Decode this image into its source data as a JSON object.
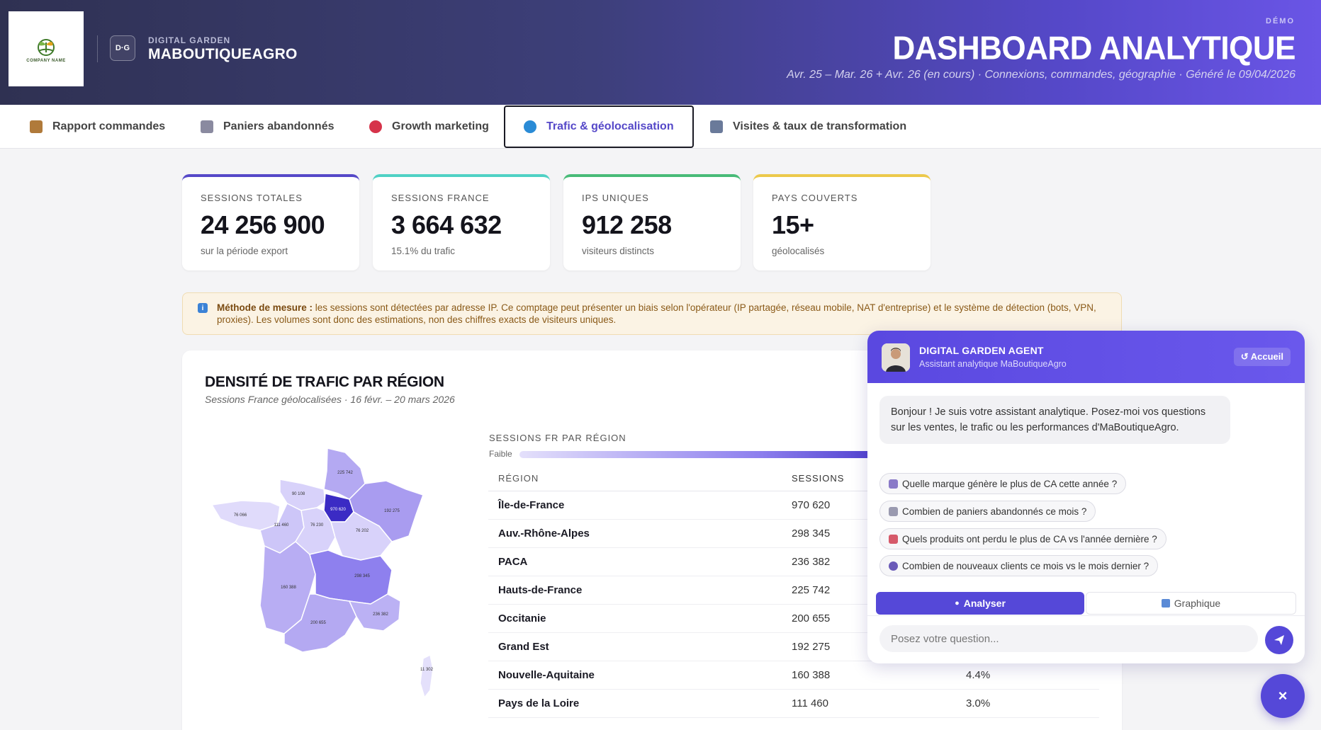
{
  "header": {
    "logo_text": "COMPANY NAME",
    "badge": "D·G",
    "brand_small": "DIGITAL GARDEN",
    "brand_big": "MABOUTIQUEAGRO",
    "demo": "DÉMO",
    "title": "DASHBOARD ANALYTIQUE",
    "subtitle": "Avr. 25 – Mar. 26 + Avr. 26 (en cours) · Connexions, commandes, géographie · Généré le 09/04/2026"
  },
  "tabs": [
    {
      "label": "Rapport commandes",
      "icon": "package-icon",
      "color": "#b07a3a"
    },
    {
      "label": "Paniers abandonnés",
      "icon": "cart-icon",
      "color": "#8a8aa0"
    },
    {
      "label": "Growth marketing",
      "icon": "target-icon",
      "color": "#d6334a"
    },
    {
      "label": "Trafic & géolocalisation",
      "icon": "globe-icon",
      "color": "#2a8bd6"
    },
    {
      "label": "Visites & taux de transformation",
      "icon": "chart-up-icon",
      "color": "#6a7a9a"
    }
  ],
  "kpis": [
    {
      "label": "SESSIONS TOTALES",
      "value": "24 256 900",
      "sub": "sur la période export",
      "color": "#5548c8"
    },
    {
      "label": "SESSIONS FRANCE",
      "value": "3 664 632",
      "sub": "15.1% du trafic",
      "color": "#4fd1c5"
    },
    {
      "label": "IPS UNIQUES",
      "value": "912 258",
      "sub": "visiteurs distincts",
      "color": "#48bb78"
    },
    {
      "label": "PAYS COUVERTS",
      "value": "15+",
      "sub": "géolocalisés",
      "color": "#ecc94b"
    }
  ],
  "notice": {
    "icon": "info-icon",
    "bold": "Méthode de mesure :",
    "text": " les sessions sont détectées par adresse IP. Ce comptage peut présenter un biais selon l'opérateur (IP partagée, réseau mobile, NAT d'entreprise) et le système de détection (bots, VPN, proxies). Les volumes sont donc des estimations, non des chiffres exacts de visiteurs uniques."
  },
  "panel": {
    "title": "DENSITÉ DE TRAFIC PAR RÉGION",
    "subtitle": "Sessions France géolocalisées · 16 févr. – 20 mars 2026",
    "legend_label": "SESSIONS FR PAR RÉGION",
    "legend_low": "Faible",
    "columns": [
      "RÉGION",
      "SESSIONS"
    ],
    "rows": [
      {
        "region": "Île-de-France",
        "sessions": "970 620",
        "pct": ""
      },
      {
        "region": "Auv.-Rhône-Alpes",
        "sessions": "298 345",
        "pct": ""
      },
      {
        "region": "PACA",
        "sessions": "236 382",
        "pct": ""
      },
      {
        "region": "Hauts-de-France",
        "sessions": "225 742",
        "pct": ""
      },
      {
        "region": "Occitanie",
        "sessions": "200 655",
        "pct": ""
      },
      {
        "region": "Grand Est",
        "sessions": "192 275",
        "pct": ""
      },
      {
        "region": "Nouvelle-Aquitaine",
        "sessions": "160 388",
        "pct": "4.4%"
      },
      {
        "region": "Pays de la Loire",
        "sessions": "111 460",
        "pct": "3.0%"
      }
    ],
    "map_labels": {
      "idf": "970 620",
      "hdf": "225 742",
      "normandie": "90 108",
      "bretagne": "76 066",
      "pdl": "111 460",
      "cvl": "76 230",
      "grand_est": "192 275",
      "bfc": "76 202",
      "naq": "160 388",
      "ara": "298 345",
      "occ": "200 655",
      "paca": "236 382",
      "corse": "11 302"
    }
  },
  "chat": {
    "name": "DIGITAL GARDEN AGENT",
    "role": "Assistant analytique MaBoutiqueAgro",
    "home": "↺ Accueil",
    "greeting": "Bonjour ! Je suis votre assistant analytique. Posez-moi vos questions sur les ventes, le trafic ou les performances d'MaBoutiqueAgro.",
    "suggestions": [
      {
        "text": "Quelle marque génère le plus de CA cette année ?",
        "icon": "factory-icon"
      },
      {
        "text": "Combien de paniers abandonnés ce mois ?",
        "icon": "cart-icon"
      },
      {
        "text": "Quels produits ont perdu le plus de CA vs l'année dernière ?",
        "icon": "chart-down-icon"
      },
      {
        "text": "Combien de nouveaux clients ce mois vs le mois dernier ?",
        "icon": "user-icon"
      }
    ],
    "mode_analyse": "Analyser",
    "mode_graph": "Graphique",
    "input_placeholder": "Posez votre question...",
    "close": "×"
  }
}
